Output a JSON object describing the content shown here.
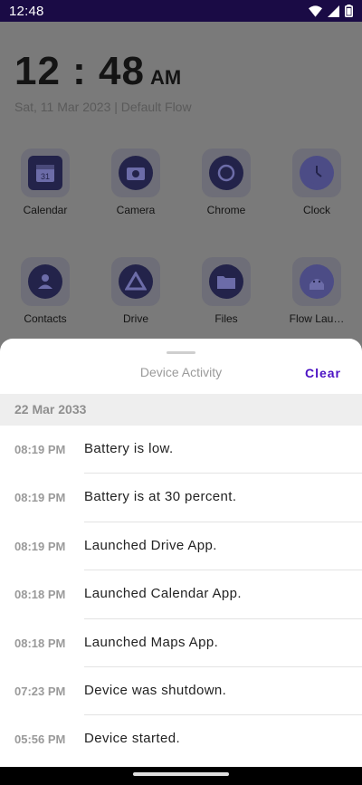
{
  "status_bar": {
    "time": "12:48",
    "icons": [
      "wifi-icon",
      "signal-icon",
      "battery-icon"
    ]
  },
  "launcher": {
    "clock_hm": "12 : 48",
    "clock_ampm": "AM",
    "date_line": "Sat, 11 Mar 2023  |  Default Flow",
    "apps": [
      {
        "label": "Calendar",
        "icon": "calendar-icon"
      },
      {
        "label": "Camera",
        "icon": "camera-icon"
      },
      {
        "label": "Chrome",
        "icon": "chrome-icon"
      },
      {
        "label": "Clock",
        "icon": "clock-icon"
      },
      {
        "label": "Contacts",
        "icon": "contacts-icon"
      },
      {
        "label": "Drive",
        "icon": "drive-icon"
      },
      {
        "label": "Files",
        "icon": "files-icon"
      },
      {
        "label": "Flow Lau…",
        "icon": "android-icon"
      }
    ],
    "calendar_day": "31"
  },
  "sheet": {
    "title": "Device Activity",
    "clear_label": "Clear",
    "date_header": "22 Mar 2033",
    "items": [
      {
        "time": "08:19 PM",
        "text": "Battery is low."
      },
      {
        "time": "08:19 PM",
        "text": "Battery is at 30 percent."
      },
      {
        "time": "08:19 PM",
        "text": "Launched Drive App."
      },
      {
        "time": "08:18 PM",
        "text": "Launched Calendar App."
      },
      {
        "time": "08:18 PM",
        "text": "Launched Maps App."
      },
      {
        "time": "07:23 PM",
        "text": "Device was shutdown."
      },
      {
        "time": "05:56 PM",
        "text": "Device started."
      }
    ]
  },
  "colors": {
    "status_bar": "#1a0b45",
    "accent": "#4b12c4"
  }
}
